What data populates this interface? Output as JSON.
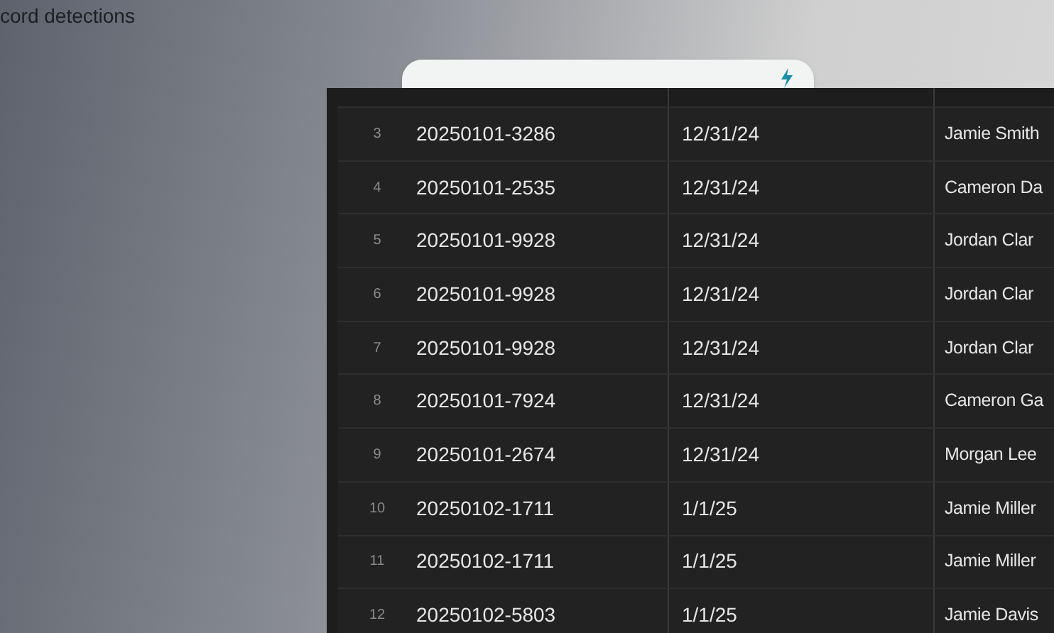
{
  "heading": "cord detections",
  "table": {
    "rows": [
      {
        "number": "3",
        "id": "20250101-3286",
        "date": "12/31/24",
        "name": "Jamie Smith"
      },
      {
        "number": "4",
        "id": "20250101-2535",
        "date": "12/31/24",
        "name": "Cameron Da"
      },
      {
        "number": "5",
        "id": "20250101-9928",
        "date": "12/31/24",
        "name": "Jordan Clar"
      },
      {
        "number": "6",
        "id": "20250101-9928",
        "date": "12/31/24",
        "name": "Jordan Clar"
      },
      {
        "number": "7",
        "id": "20250101-9928",
        "date": "12/31/24",
        "name": "Jordan Clar"
      },
      {
        "number": "8",
        "id": "20250101-7924",
        "date": "12/31/24",
        "name": "Cameron Ga"
      },
      {
        "number": "9",
        "id": "20250101-2674",
        "date": "12/31/24",
        "name": "Morgan Lee"
      },
      {
        "number": "10",
        "id": "20250102-1711",
        "date": "1/1/25",
        "name": "Jamie Miller"
      },
      {
        "number": "11",
        "id": "20250102-1711",
        "date": "1/1/25",
        "name": "Jamie Miller"
      },
      {
        "number": "12",
        "id": "20250102-5803",
        "date": "1/1/25",
        "name": "Jamie Davis"
      }
    ]
  }
}
